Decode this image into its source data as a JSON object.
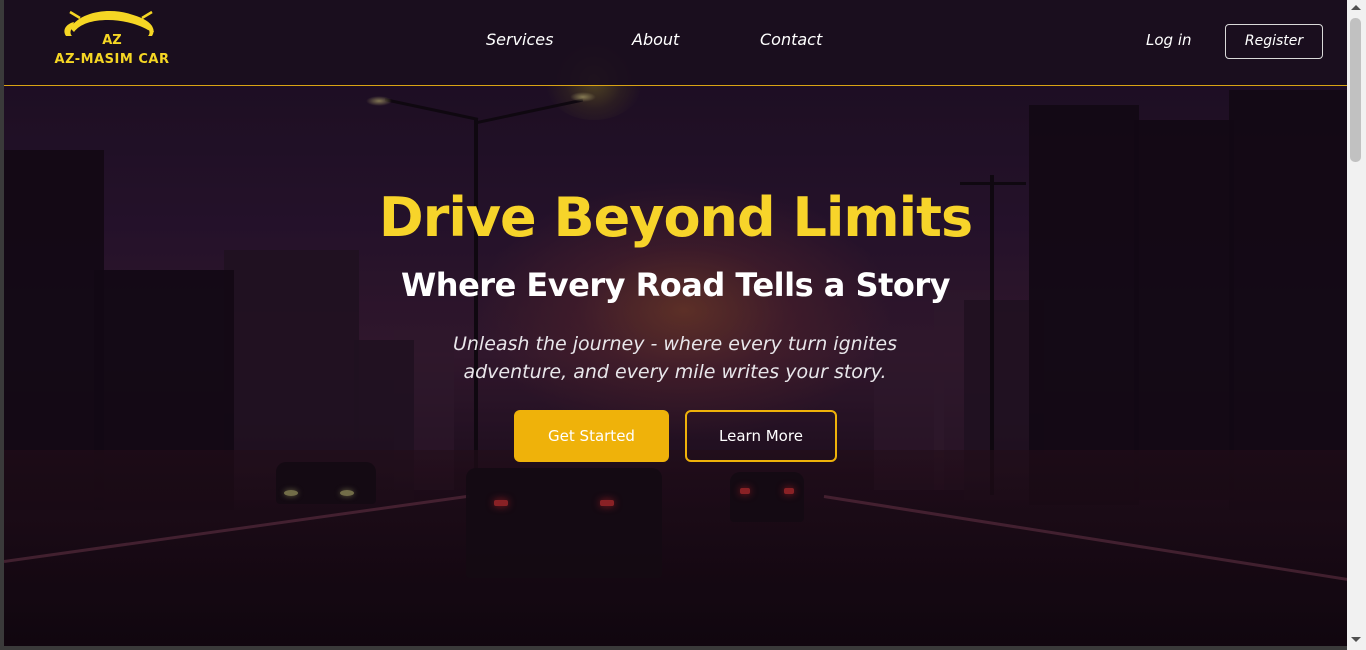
{
  "brand": {
    "logo_text": "AZ-MASIM CAR",
    "logo_monogram": "AZ",
    "accent_color": "#f5d624"
  },
  "nav": {
    "links": [
      {
        "label": "Services"
      },
      {
        "label": "About"
      },
      {
        "label": "Contact"
      }
    ],
    "login_label": "Log in",
    "register_label": "Register"
  },
  "hero": {
    "title": "Drive Beyond Limits",
    "subtitle": "Where Every Road Tells a Story",
    "description": "Unleash the journey - where every turn ignites adventure, and every mile writes your story.",
    "primary_button": "Get Started",
    "secondary_button": "Learn More",
    "title_color": "#f7d42a",
    "button_color": "#efb20a"
  },
  "icons": {
    "logo": "car-logo-icon",
    "scroll_up": "chevron-up-icon",
    "scroll_down": "chevron-down-icon"
  }
}
